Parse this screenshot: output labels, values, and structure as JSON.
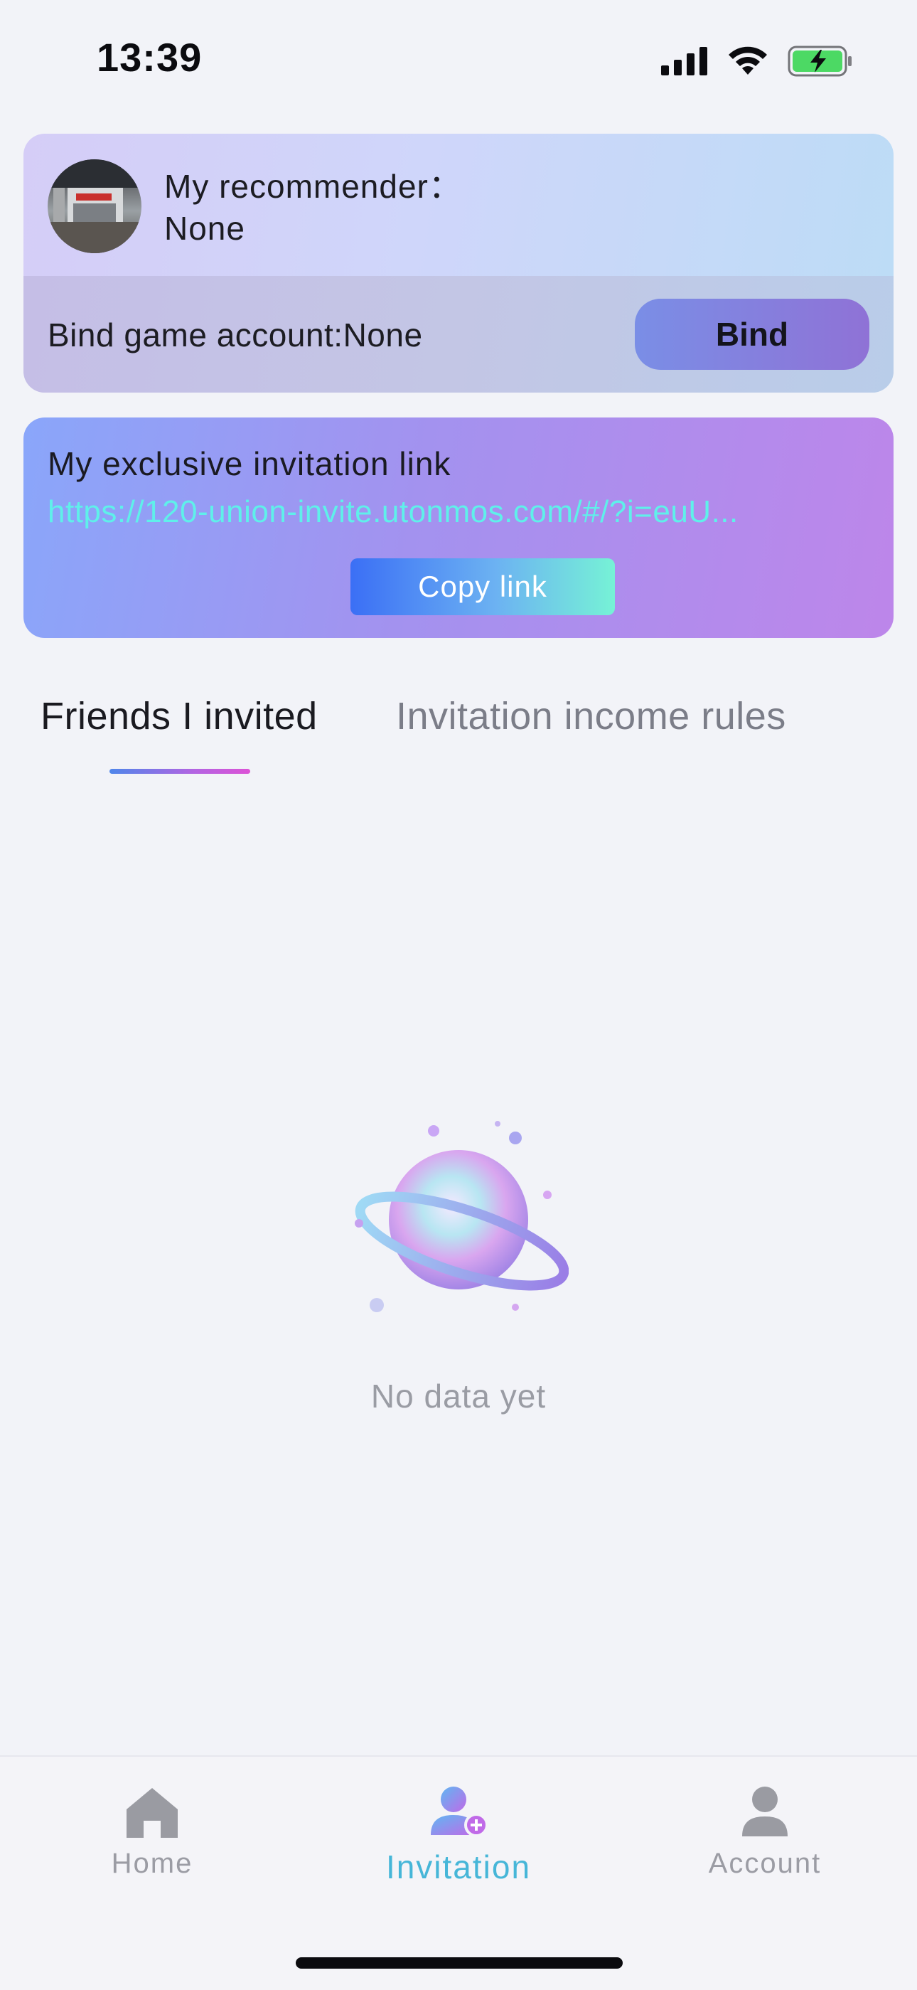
{
  "status_bar": {
    "time": "13:39",
    "icons": [
      "signal-icon",
      "wifi-icon",
      "battery-charging-icon"
    ],
    "battery_color": "#4cd964"
  },
  "recommender": {
    "label": "My recommender：",
    "value": "None",
    "bind_label": "Bind game account:None",
    "bind_button": "Bind"
  },
  "invitation": {
    "title": "My exclusive invitation link",
    "url": "https://120-union-invite.utonmos.com/#/?i=euU...",
    "copy_button": "Copy link"
  },
  "tabs": [
    {
      "label": "Friends I invited",
      "active": true
    },
    {
      "label": "Invitation income rules",
      "active": false
    }
  ],
  "empty_state": {
    "text": "No data yet",
    "icon": "planet-icon"
  },
  "nav": {
    "items": [
      {
        "label": "Home",
        "icon": "home-icon",
        "active": false
      },
      {
        "label": "Invitation",
        "icon": "invite-user-icon",
        "active": true
      },
      {
        "label": "Account",
        "icon": "account-icon",
        "active": false
      }
    ]
  },
  "colors": {
    "accent_cyan": "#46b6d8",
    "link_color": "#5ff0ea",
    "inactive_gray": "#9b9ca4"
  }
}
